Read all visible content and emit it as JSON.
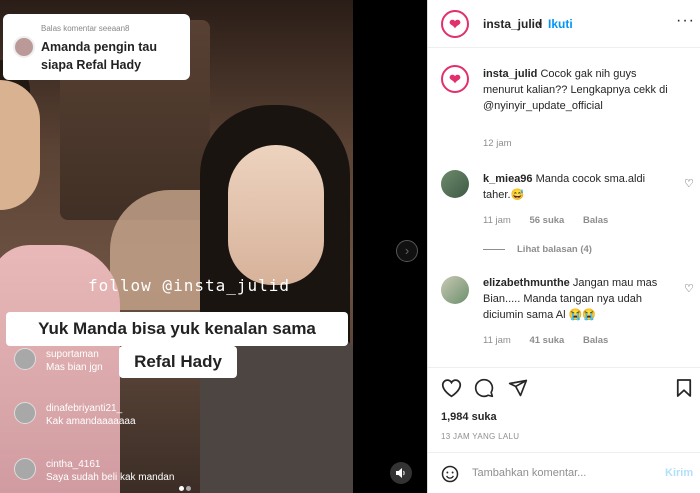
{
  "media": {
    "bubble_small": "Balas komentar seeaan8",
    "bubble_text": "Amanda pengin tau siapa Refal Hady",
    "watermark": "follow @insta_julid",
    "caption_line1": "Yuk Manda bisa yuk kenalan sama",
    "caption_line2": "Refal Hady",
    "live_comments": [
      {
        "name": "suportaman",
        "msg": "Mas bian jgn"
      },
      {
        "name": "dinafebriyanti21_",
        "msg": "Kak amandaaaaaaa"
      },
      {
        "name": "cintha_4161",
        "msg": "Saya sudah beli kak mandan"
      }
    ]
  },
  "header": {
    "username": "insta_julid",
    "separator": "•",
    "follow": "Ikuti",
    "more": "···"
  },
  "caption": {
    "username": "insta_julid",
    "text": "Cocok gak nih guys menurut kalian?? Lengkapnya cekk di @nyinyir_update_official",
    "time": "12 jam"
  },
  "comments": [
    {
      "username": "k_miea96",
      "text": "Manda cocok sma.aldi taher.😅",
      "time": "11 jam",
      "likes": "56 suka",
      "reply": "Balas",
      "view_replies": "Lihat balasan (4)"
    },
    {
      "username": "elizabethmunthe",
      "text": "Jangan mau mas Bian..... Manda tangan nya udah diciumin sama Al 😭😭",
      "time": "11 jam",
      "likes": "41 suka",
      "reply": "Balas"
    }
  ],
  "likes_count": "1,984 suka",
  "posted": "13 JAM YANG LALU",
  "add_comment": {
    "placeholder": "Tambahkan komentar...",
    "post": "Kirim"
  },
  "colors": {
    "accent": "#0095f6",
    "brand": "#e1306c",
    "muted": "#8e8e8e"
  }
}
